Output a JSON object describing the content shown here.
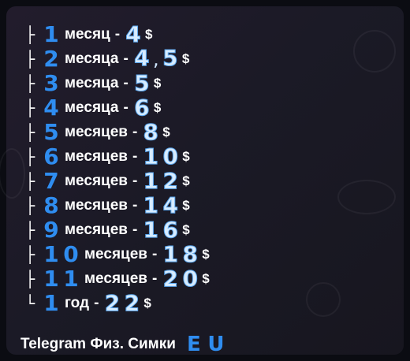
{
  "tree_glyphs": {
    "branch": "├",
    "end": "└"
  },
  "rows": [
    {
      "number": "1",
      "unit": "месяц",
      "dash": "-",
      "price": "4",
      "currency": "$"
    },
    {
      "number": "2",
      "unit": "месяца",
      "dash": "-",
      "price": "4,5",
      "currency": "$"
    },
    {
      "number": "3",
      "unit": "месяца",
      "dash": "-",
      "price": "5",
      "currency": "$"
    },
    {
      "number": "4",
      "unit": "месяца",
      "dash": "-",
      "price": "6",
      "currency": "$"
    },
    {
      "number": "5",
      "unit": "месяцев",
      "dash": "-",
      "price": "8",
      "currency": "$"
    },
    {
      "number": "6",
      "unit": "месяцев",
      "dash": "-",
      "price": "10",
      "currency": "$"
    },
    {
      "number": "7",
      "unit": "месяцев",
      "dash": "-",
      "price": "12",
      "currency": "$"
    },
    {
      "number": "8",
      "unit": "месяцев",
      "dash": "-",
      "price": "14",
      "currency": "$"
    },
    {
      "number": "9",
      "unit": "месяцев",
      "dash": "-",
      "price": "16",
      "currency": "$"
    },
    {
      "number": "10",
      "unit": "месяцев",
      "dash": "-",
      "price": "18",
      "currency": "$"
    },
    {
      "number": "11",
      "unit": "месяцев",
      "dash": "-",
      "price": "20",
      "currency": "$"
    },
    {
      "number": "1",
      "unit": "год",
      "dash": "-",
      "price": "22",
      "currency": "$"
    }
  ],
  "footer": {
    "channel": "Telegram Физ. Симки",
    "flag_letters": [
      "E",
      "U"
    ]
  },
  "colors": {
    "key_blue": "#2f8df0",
    "price_light": "#d7ecff",
    "background": "#1b1a26"
  }
}
